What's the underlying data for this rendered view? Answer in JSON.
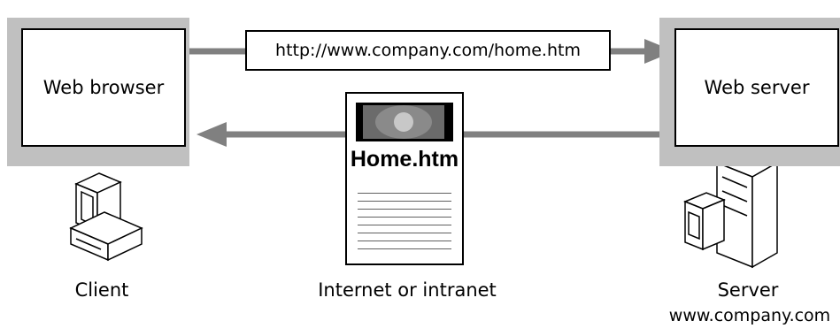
{
  "client_box": {
    "label": "Web browser"
  },
  "server_box": {
    "label": "Web server"
  },
  "request": {
    "url": "http://www.company.com/home.htm"
  },
  "document": {
    "title": "Home.htm"
  },
  "labels": {
    "client": "Client",
    "network": "Internet or intranet",
    "server": "Server",
    "server_host": "www.company.com"
  },
  "colors": {
    "shadow": "#c0c0c0",
    "arrow": "#808080",
    "banner": "#000000"
  },
  "icons": [
    "client-computer-icon",
    "server-computer-icon",
    "web-page-icon"
  ]
}
